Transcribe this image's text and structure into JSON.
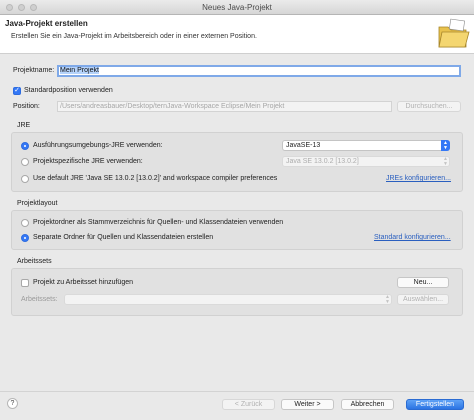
{
  "window": {
    "title": "Neues Java-Projekt"
  },
  "header": {
    "title": "Java-Projekt erstellen",
    "description": "Erstellen Sie ein Java-Projekt im Arbeitsbereich oder in einer externen Position."
  },
  "project": {
    "name_label": "Projektname:",
    "name_value": "Mein Projekt",
    "default_location_label": "Standardposition verwenden",
    "default_location_checked": true,
    "location_label": "Position:",
    "location_value": "/Users/andreasbauer/Desktop/ternJava-Workspace Eclipse/Mein Projekt",
    "browse_label": "Durchsuchen..."
  },
  "jre": {
    "title": "JRE",
    "option_exec_env": "Ausführungsumgebungs-JRE verwenden:",
    "exec_env_value": "JavaSE-13",
    "option_project_jre": "Projektspezifische JRE verwenden:",
    "project_jre_value": "Java SE 13.0.2 [13.0.2]",
    "option_default_jre": "Use default JRE 'Java SE 13.0.2 [13.0.2]' and workspace compiler preferences",
    "configure_link": "JREs konfigurieren..."
  },
  "layout": {
    "title": "Projektlayout",
    "option_single": "Projektordner als Stammverzeichnis für Quellen- und Klassendateien verwenden",
    "option_separate": "Separate Ordner für Quellen und Klassendateien erstellen",
    "configure_link": "Standard konfigurieren..."
  },
  "worksets": {
    "title": "Arbeitssets",
    "add_label": "Projekt zu Arbeitsset hinzufügen",
    "new_button": "Neu...",
    "sets_label": "Arbeitssets:",
    "select_button": "Auswählen..."
  },
  "footer": {
    "help_icon": "?",
    "back": "< Zurück",
    "next": "Weiter >",
    "cancel": "Abbrechen",
    "finish": "Fertigstellen"
  },
  "colors": {
    "accent": "#3478f6",
    "link": "#2a5fbf",
    "selection": "#b5d3fb"
  },
  "icons": [
    "folder-wizard-icon",
    "help-icon",
    "checkbox-checked-icon",
    "radio-icon",
    "select-arrow-icon"
  ]
}
